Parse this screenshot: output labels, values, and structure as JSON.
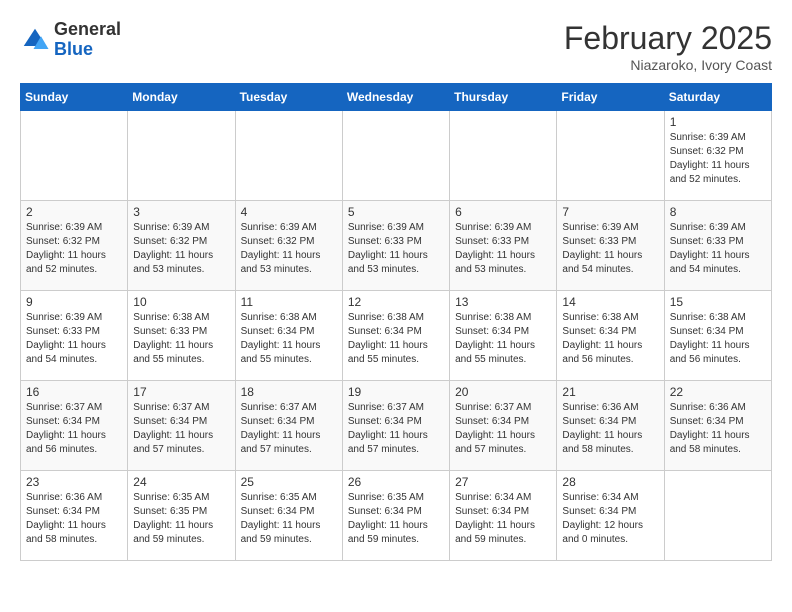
{
  "header": {
    "logo": {
      "general": "General",
      "blue": "Blue"
    },
    "title": "February 2025",
    "location": "Niazaroko, Ivory Coast"
  },
  "weekdays": [
    "Sunday",
    "Monday",
    "Tuesday",
    "Wednesday",
    "Thursday",
    "Friday",
    "Saturday"
  ],
  "weeks": [
    [
      {
        "day": "",
        "info": ""
      },
      {
        "day": "",
        "info": ""
      },
      {
        "day": "",
        "info": ""
      },
      {
        "day": "",
        "info": ""
      },
      {
        "day": "",
        "info": ""
      },
      {
        "day": "",
        "info": ""
      },
      {
        "day": "1",
        "info": "Sunrise: 6:39 AM\nSunset: 6:32 PM\nDaylight: 11 hours\nand 52 minutes."
      }
    ],
    [
      {
        "day": "2",
        "info": "Sunrise: 6:39 AM\nSunset: 6:32 PM\nDaylight: 11 hours\nand 52 minutes."
      },
      {
        "day": "3",
        "info": "Sunrise: 6:39 AM\nSunset: 6:32 PM\nDaylight: 11 hours\nand 53 minutes."
      },
      {
        "day": "4",
        "info": "Sunrise: 6:39 AM\nSunset: 6:32 PM\nDaylight: 11 hours\nand 53 minutes."
      },
      {
        "day": "5",
        "info": "Sunrise: 6:39 AM\nSunset: 6:33 PM\nDaylight: 11 hours\nand 53 minutes."
      },
      {
        "day": "6",
        "info": "Sunrise: 6:39 AM\nSunset: 6:33 PM\nDaylight: 11 hours\nand 53 minutes."
      },
      {
        "day": "7",
        "info": "Sunrise: 6:39 AM\nSunset: 6:33 PM\nDaylight: 11 hours\nand 54 minutes."
      },
      {
        "day": "8",
        "info": "Sunrise: 6:39 AM\nSunset: 6:33 PM\nDaylight: 11 hours\nand 54 minutes."
      }
    ],
    [
      {
        "day": "9",
        "info": "Sunrise: 6:39 AM\nSunset: 6:33 PM\nDaylight: 11 hours\nand 54 minutes."
      },
      {
        "day": "10",
        "info": "Sunrise: 6:38 AM\nSunset: 6:33 PM\nDaylight: 11 hours\nand 55 minutes."
      },
      {
        "day": "11",
        "info": "Sunrise: 6:38 AM\nSunset: 6:34 PM\nDaylight: 11 hours\nand 55 minutes."
      },
      {
        "day": "12",
        "info": "Sunrise: 6:38 AM\nSunset: 6:34 PM\nDaylight: 11 hours\nand 55 minutes."
      },
      {
        "day": "13",
        "info": "Sunrise: 6:38 AM\nSunset: 6:34 PM\nDaylight: 11 hours\nand 55 minutes."
      },
      {
        "day": "14",
        "info": "Sunrise: 6:38 AM\nSunset: 6:34 PM\nDaylight: 11 hours\nand 56 minutes."
      },
      {
        "day": "15",
        "info": "Sunrise: 6:38 AM\nSunset: 6:34 PM\nDaylight: 11 hours\nand 56 minutes."
      }
    ],
    [
      {
        "day": "16",
        "info": "Sunrise: 6:37 AM\nSunset: 6:34 PM\nDaylight: 11 hours\nand 56 minutes."
      },
      {
        "day": "17",
        "info": "Sunrise: 6:37 AM\nSunset: 6:34 PM\nDaylight: 11 hours\nand 57 minutes."
      },
      {
        "day": "18",
        "info": "Sunrise: 6:37 AM\nSunset: 6:34 PM\nDaylight: 11 hours\nand 57 minutes."
      },
      {
        "day": "19",
        "info": "Sunrise: 6:37 AM\nSunset: 6:34 PM\nDaylight: 11 hours\nand 57 minutes."
      },
      {
        "day": "20",
        "info": "Sunrise: 6:37 AM\nSunset: 6:34 PM\nDaylight: 11 hours\nand 57 minutes."
      },
      {
        "day": "21",
        "info": "Sunrise: 6:36 AM\nSunset: 6:34 PM\nDaylight: 11 hours\nand 58 minutes."
      },
      {
        "day": "22",
        "info": "Sunrise: 6:36 AM\nSunset: 6:34 PM\nDaylight: 11 hours\nand 58 minutes."
      }
    ],
    [
      {
        "day": "23",
        "info": "Sunrise: 6:36 AM\nSunset: 6:34 PM\nDaylight: 11 hours\nand 58 minutes."
      },
      {
        "day": "24",
        "info": "Sunrise: 6:35 AM\nSunset: 6:35 PM\nDaylight: 11 hours\nand 59 minutes."
      },
      {
        "day": "25",
        "info": "Sunrise: 6:35 AM\nSunset: 6:34 PM\nDaylight: 11 hours\nand 59 minutes."
      },
      {
        "day": "26",
        "info": "Sunrise: 6:35 AM\nSunset: 6:34 PM\nDaylight: 11 hours\nand 59 minutes."
      },
      {
        "day": "27",
        "info": "Sunrise: 6:34 AM\nSunset: 6:34 PM\nDaylight: 11 hours\nand 59 minutes."
      },
      {
        "day": "28",
        "info": "Sunrise: 6:34 AM\nSunset: 6:34 PM\nDaylight: 12 hours\nand 0 minutes."
      },
      {
        "day": "",
        "info": ""
      }
    ]
  ]
}
